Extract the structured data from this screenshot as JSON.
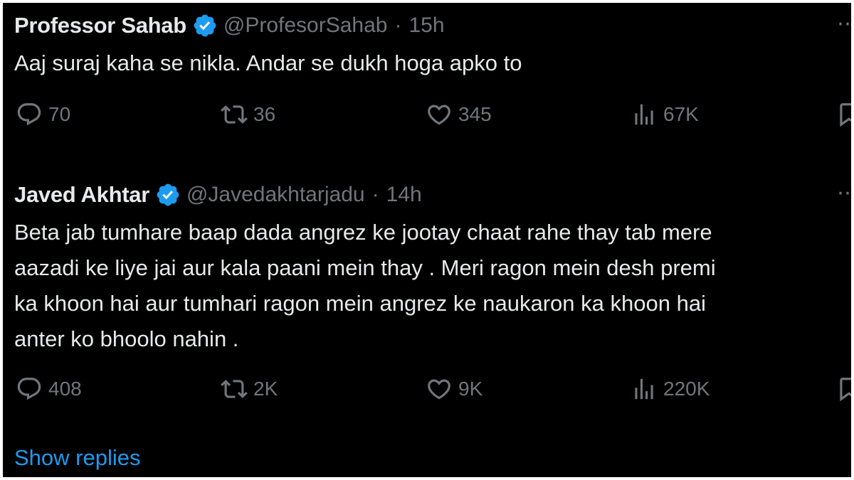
{
  "colors": {
    "background": "#000000",
    "primary_text": "#e7e9ea",
    "secondary_text": "#71767b",
    "link": "#1d9bf0",
    "verified_badge": "#1d9bf0"
  },
  "tweets": [
    {
      "name": "Professor Sahab",
      "handle": "@ProfesorSahab",
      "separator": "·",
      "time": "15h",
      "more": "⋯",
      "text": "Aaj suraj kaha se nikla. Andar se dukh hoga apko to",
      "replies": "70",
      "retweets": "36",
      "likes": "345",
      "views": "67K"
    },
    {
      "name": "Javed Akhtar",
      "handle": "@Javedakhtarjadu",
      "separator": "·",
      "time": "14h",
      "more": "⋯",
      "text": "Beta jab tumhare baap dada angrez ke jootay chaat rahe thay tab mere\naazadi ke liye jai aur kala paani mein thay . Meri ragon mein desh premi\nka khoon hai aur tumhari ragon mein angrez ke naukaron ka khoon hai\nanter ko bhoolo nahin .",
      "replies": "408",
      "retweets": "2K",
      "likes": "9K",
      "views": "220K"
    }
  ],
  "show_replies": "Show replies",
  "icons": {
    "verified": "verified-badge-icon",
    "reply": "reply-icon",
    "retweet": "retweet-icon",
    "like": "heart-icon",
    "views": "views-icon",
    "bookmark": "bookmark-icon"
  }
}
